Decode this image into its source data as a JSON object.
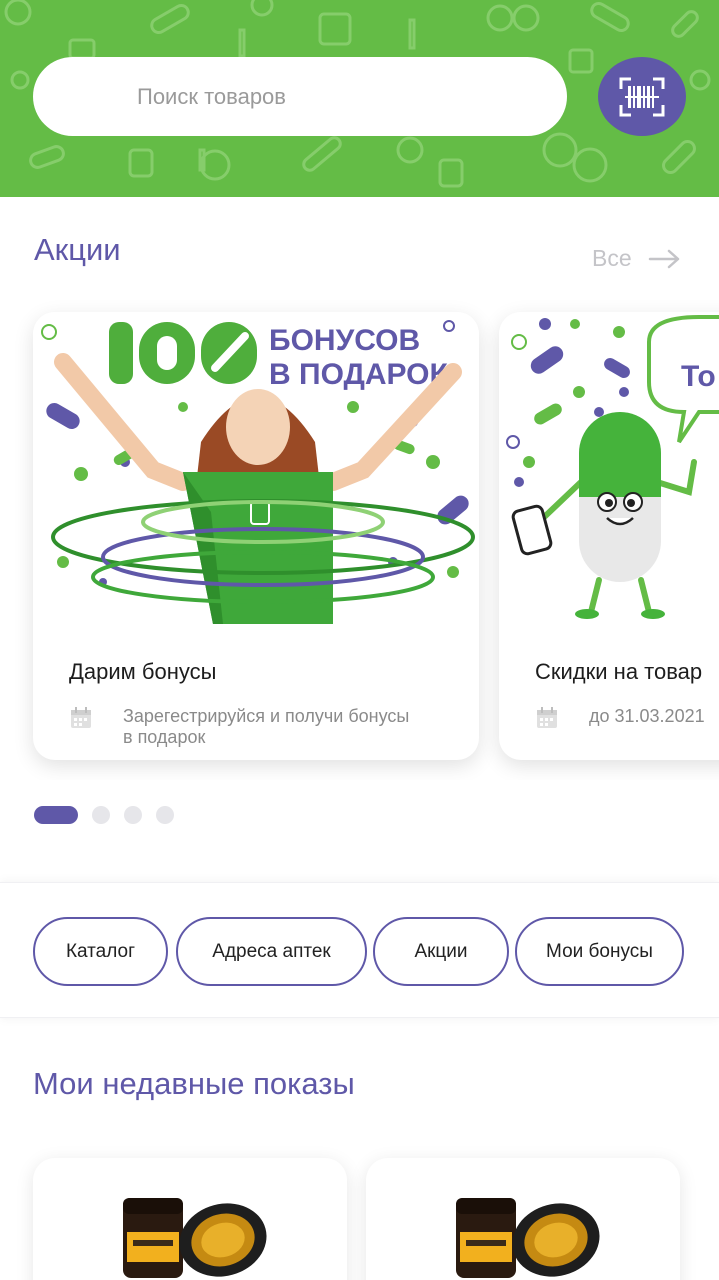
{
  "search": {
    "placeholder": "Поиск товаров"
  },
  "icons": {
    "scan": "barcode-scan-icon",
    "arrow": "arrow-right-icon",
    "calendar": "calendar-icon"
  },
  "colors": {
    "brand_green": "#64bc46",
    "brand_purple": "#5f58a8",
    "text_muted": "#8a8a8a"
  },
  "promotions": {
    "title": "Акции",
    "all_label": "Все",
    "cards": [
      {
        "title": "Дарим бонусы",
        "subtitle": "Зарегестрируйся и получи бонусы в подарок",
        "banner_big": "100",
        "banner_line1": "БОНУСОВ",
        "banner_line2": "В ПОДАРОК"
      },
      {
        "title": "Скидки на товар",
        "subtitle": "до 31.03.2021",
        "bubble": "То"
      }
    ],
    "pagination": {
      "count": 4,
      "active": 0
    }
  },
  "quick_links": [
    "Каталог",
    "Адреса аптек",
    "Акции",
    "Мои бонусы"
  ],
  "recent": {
    "title": "Мои недавные показы"
  }
}
